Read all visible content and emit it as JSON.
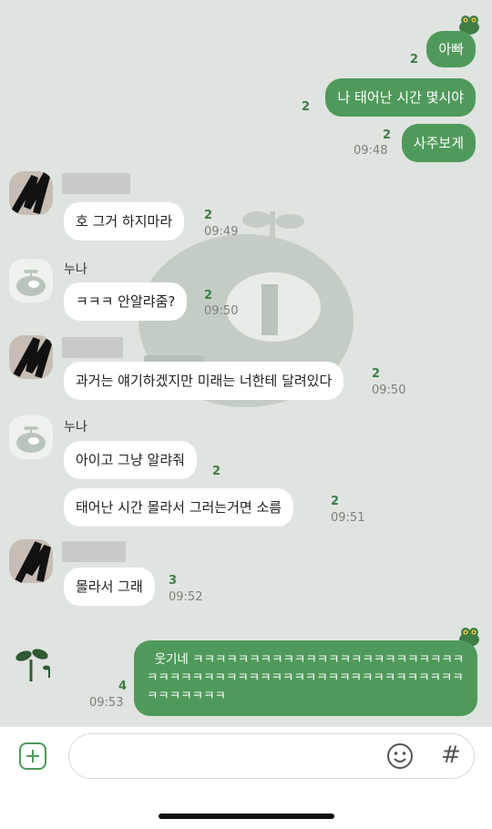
{
  "colors": {
    "my_bubble": "#4f9a5a",
    "other_bubble": "#ffffff",
    "background": "#dfe4e0",
    "unread": "#3f7d47"
  },
  "messages": {
    "m1": {
      "text": "아빠",
      "unread": "2"
    },
    "m2": {
      "text": "나 태어난 시간 몇시야",
      "unread": "2"
    },
    "m3": {
      "text": "사주보게",
      "unread": "2",
      "time": "09:48"
    },
    "m4": {
      "text": "호 그거  하지마라",
      "unread": "2",
      "time": "09:49"
    },
    "sender_sister": "누나",
    "m5": {
      "text": "ㅋㅋㅋ 안알랴줌?",
      "unread": "2",
      "time": "09:50"
    },
    "m6": {
      "text": "과거는 얘기하겠지만 미래는 너한테 달려있다",
      "unread": "2",
      "time": "09:50"
    },
    "m7": {
      "text": "아이고 그냥 알랴줘",
      "unread": "2"
    },
    "m8": {
      "text": "태어난 시간 몰라서 그러는거면     소름",
      "unread": "2",
      "time": "09:51"
    },
    "m9": {
      "text": "몰라서 그래",
      "unread": "3",
      "time": "09:52"
    },
    "m10": {
      "text": "  웃기네 ㅋㅋㅋㅋㅋㅋㅋㅋㅋㅋㅋㅋㅋㅋㅋㅋㅋㅋㅋㅋㅋㅋㅋㅋㅋㅋㅋㅋㅋㅋㅋㅋㅋㅋㅋㅋㅋㅋㅋㅋㅋㅋㅋㅋㅋㅋㅋㅋㅋㅋㅋㅋㅋㅋㅋㅋㅋㅋㅋ",
      "unread": "4",
      "time": "09:53"
    }
  },
  "icons": {
    "add": "plus-square-icon",
    "emoji": "smiley-icon",
    "hashtag": "hash-icon",
    "hash_glyph": "#"
  }
}
